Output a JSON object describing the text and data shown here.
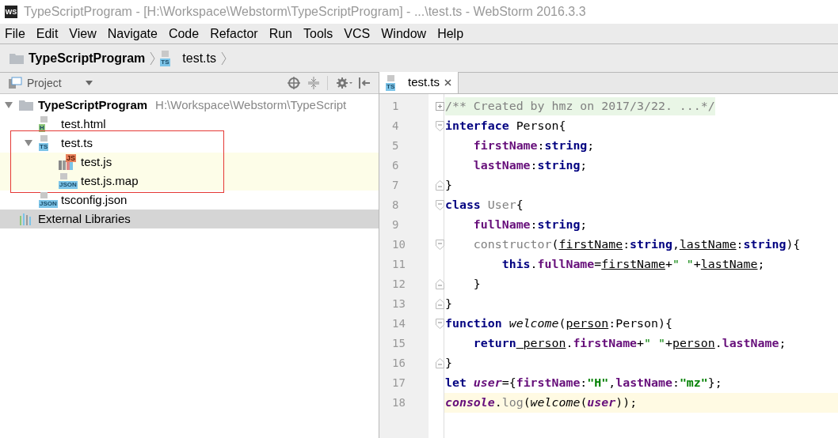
{
  "window": {
    "title": "TypeScriptProgram - [H:\\Workspace\\Webstorm\\TypeScriptProgram] - ...\\test.ts - WebStorm 2016.3.3",
    "app_badge": "WS"
  },
  "menu": [
    "File",
    "Edit",
    "View",
    "Navigate",
    "Code",
    "Refactor",
    "Run",
    "Tools",
    "VCS",
    "Window",
    "Help"
  ],
  "breadcrumb": [
    {
      "label": "TypeScriptProgram",
      "kind": "folder"
    },
    {
      "label": "test.ts",
      "kind": "file",
      "icon_text": "TS"
    }
  ],
  "project_panel": {
    "title": "Project",
    "tree": [
      {
        "label": "TypeScriptProgram",
        "path": "H:\\Workspace\\Webstorm\\TypeScript",
        "kind": "folder",
        "expanded": true,
        "selected": false,
        "highlighted": false,
        "annotated": false,
        "children": [
          {
            "label": "test.html",
            "kind": "file",
            "icon_text": "H",
            "color": "#8fc77a",
            "selected": false,
            "highlighted": false,
            "annotated": false
          },
          {
            "label": "test.ts",
            "kind": "file",
            "icon_text": "TS",
            "color": "#7cc4e8",
            "expanded": true,
            "selected": false,
            "highlighted": false,
            "annotated": true,
            "children": [
              {
                "label": "test.js",
                "kind": "js",
                "icon_text": "JS",
                "color": "#e8805a",
                "selected": false,
                "highlighted": true,
                "annotated": false
              },
              {
                "label": "test.js.map",
                "kind": "file",
                "icon_text": "JSON",
                "color": "#7cc4e8",
                "selected": false,
                "highlighted": true,
                "annotated": false
              }
            ]
          },
          {
            "label": "tsconfig.json",
            "kind": "file",
            "icon_text": "JSON",
            "color": "#7cc4e8",
            "selected": false,
            "highlighted": false,
            "annotated": false
          }
        ]
      },
      {
        "label": "External Libraries",
        "kind": "library",
        "selected": true,
        "highlighted": false,
        "annotated": false
      }
    ]
  },
  "editor": {
    "tabs": [
      {
        "label": "test.ts",
        "icon_text": "TS",
        "selected": true
      }
    ],
    "lines": [
      {
        "number": "1",
        "kind": "folded",
        "current": false,
        "tokens": [
          {
            "t": "/** Created by hmz on 2017/3/22. ...*/",
            "kind": "comment"
          }
        ]
      },
      {
        "number": "4",
        "kind": "start",
        "current": false,
        "tokens": [
          {
            "t": "interface",
            "kind": "kw"
          },
          {
            "t": " Person{",
            "kind": "plain"
          }
        ]
      },
      {
        "number": "5",
        "kind": "plain",
        "current": false,
        "tokens": [
          {
            "t": "    firstName",
            "kind": "prop"
          },
          {
            "t": ":",
            "kind": "plain"
          },
          {
            "t": "string",
            "kind": "kw"
          },
          {
            "t": ";",
            "kind": "plain"
          }
        ]
      },
      {
        "number": "6",
        "kind": "plain",
        "current": false,
        "tokens": [
          {
            "t": "    lastName",
            "kind": "prop"
          },
          {
            "t": ":",
            "kind": "plain"
          },
          {
            "t": "string",
            "kind": "kw"
          },
          {
            "t": ";",
            "kind": "plain"
          }
        ]
      },
      {
        "number": "7",
        "kind": "end",
        "current": false,
        "tokens": [
          {
            "t": "}",
            "kind": "plain"
          }
        ]
      },
      {
        "number": "8",
        "kind": "start",
        "current": false,
        "tokens": [
          {
            "t": "class",
            "kind": "kw"
          },
          {
            "t": " User",
            "kind": "dim"
          },
          {
            "t": "{",
            "kind": "plain"
          }
        ]
      },
      {
        "number": "9",
        "kind": "plain",
        "current": false,
        "tokens": [
          {
            "t": "    fullName",
            "kind": "prop"
          },
          {
            "t": ":",
            "kind": "plain"
          },
          {
            "t": "string",
            "kind": "kw"
          },
          {
            "t": ";",
            "kind": "plain"
          }
        ]
      },
      {
        "number": "10",
        "kind": "start",
        "current": false,
        "tokens": [
          {
            "t": "    constructor",
            "kind": "dim"
          },
          {
            "t": "(",
            "kind": "plain"
          },
          {
            "t": "firstName",
            "kind": "param"
          },
          {
            "t": ":",
            "kind": "plain"
          },
          {
            "t": "string",
            "kind": "kw"
          },
          {
            "t": ",",
            "kind": "plain"
          },
          {
            "t": "lastName",
            "kind": "param"
          },
          {
            "t": ":",
            "kind": "plain"
          },
          {
            "t": "string",
            "kind": "kw"
          },
          {
            "t": "){",
            "kind": "plain"
          }
        ]
      },
      {
        "number": "11",
        "kind": "plain",
        "current": false,
        "tokens": [
          {
            "t": "        this",
            "kind": "kw"
          },
          {
            "t": ".",
            "kind": "plain"
          },
          {
            "t": "fullName",
            "kind": "prop"
          },
          {
            "t": "=",
            "kind": "plain"
          },
          {
            "t": "firstName",
            "kind": "param"
          },
          {
            "t": "+",
            "kind": "plain"
          },
          {
            "t": "\" \"",
            "kind": "str"
          },
          {
            "t": "+",
            "kind": "plain"
          },
          {
            "t": "lastName",
            "kind": "param"
          },
          {
            "t": ";",
            "kind": "plain"
          }
        ]
      },
      {
        "number": "12",
        "kind": "end",
        "current": false,
        "tokens": [
          {
            "t": "    }",
            "kind": "plain"
          }
        ]
      },
      {
        "number": "13",
        "kind": "end",
        "current": false,
        "tokens": [
          {
            "t": "}",
            "kind": "plain"
          }
        ]
      },
      {
        "number": "14",
        "kind": "start",
        "current": false,
        "tokens": [
          {
            "t": "function",
            "kind": "kw"
          },
          {
            "t": " welcome",
            "kind": "fn"
          },
          {
            "t": "(",
            "kind": "plain"
          },
          {
            "t": "person",
            "kind": "param"
          },
          {
            "t": ":Person){",
            "kind": "plain"
          }
        ]
      },
      {
        "number": "15",
        "kind": "plain",
        "current": false,
        "tokens": [
          {
            "t": "    return",
            "kind": "kw"
          },
          {
            "t": " person",
            "kind": "param"
          },
          {
            "t": ".",
            "kind": "plain"
          },
          {
            "t": "firstName",
            "kind": "prop"
          },
          {
            "t": "+",
            "kind": "plain"
          },
          {
            "t": "\" \"",
            "kind": "str"
          },
          {
            "t": "+",
            "kind": "plain"
          },
          {
            "t": "person",
            "kind": "param"
          },
          {
            "t": ".",
            "kind": "plain"
          },
          {
            "t": "lastName",
            "kind": "prop"
          },
          {
            "t": ";",
            "kind": "plain"
          }
        ]
      },
      {
        "number": "16",
        "kind": "end",
        "current": false,
        "tokens": [
          {
            "t": "}",
            "kind": "plain"
          }
        ]
      },
      {
        "number": "17",
        "kind": "plain",
        "current": false,
        "tokens": [
          {
            "t": "let",
            "kind": "kw"
          },
          {
            "t": " user",
            "kind": "gvar"
          },
          {
            "t": "={",
            "kind": "plain"
          },
          {
            "t": "firstName",
            "kind": "prop"
          },
          {
            "t": ":",
            "kind": "plain"
          },
          {
            "t": "\"H\"",
            "kind": "strb"
          },
          {
            "t": ",",
            "kind": "plain"
          },
          {
            "t": "lastName",
            "kind": "prop"
          },
          {
            "t": ":",
            "kind": "plain"
          },
          {
            "t": "\"mz\"",
            "kind": "strb"
          },
          {
            "t": "};",
            "kind": "plain"
          }
        ]
      },
      {
        "number": "18",
        "kind": "plain",
        "current": true,
        "tokens": [
          {
            "t": "console",
            "kind": "gvar"
          },
          {
            "t": ".",
            "kind": "plain"
          },
          {
            "t": "log",
            "kind": "dim"
          },
          {
            "t": "(",
            "kind": "plain"
          },
          {
            "t": "welcome",
            "kind": "fn"
          },
          {
            "t": "(",
            "kind": "plain"
          },
          {
            "t": "user",
            "kind": "gvar"
          },
          {
            "t": "));",
            "kind": "plain"
          }
        ]
      }
    ]
  }
}
